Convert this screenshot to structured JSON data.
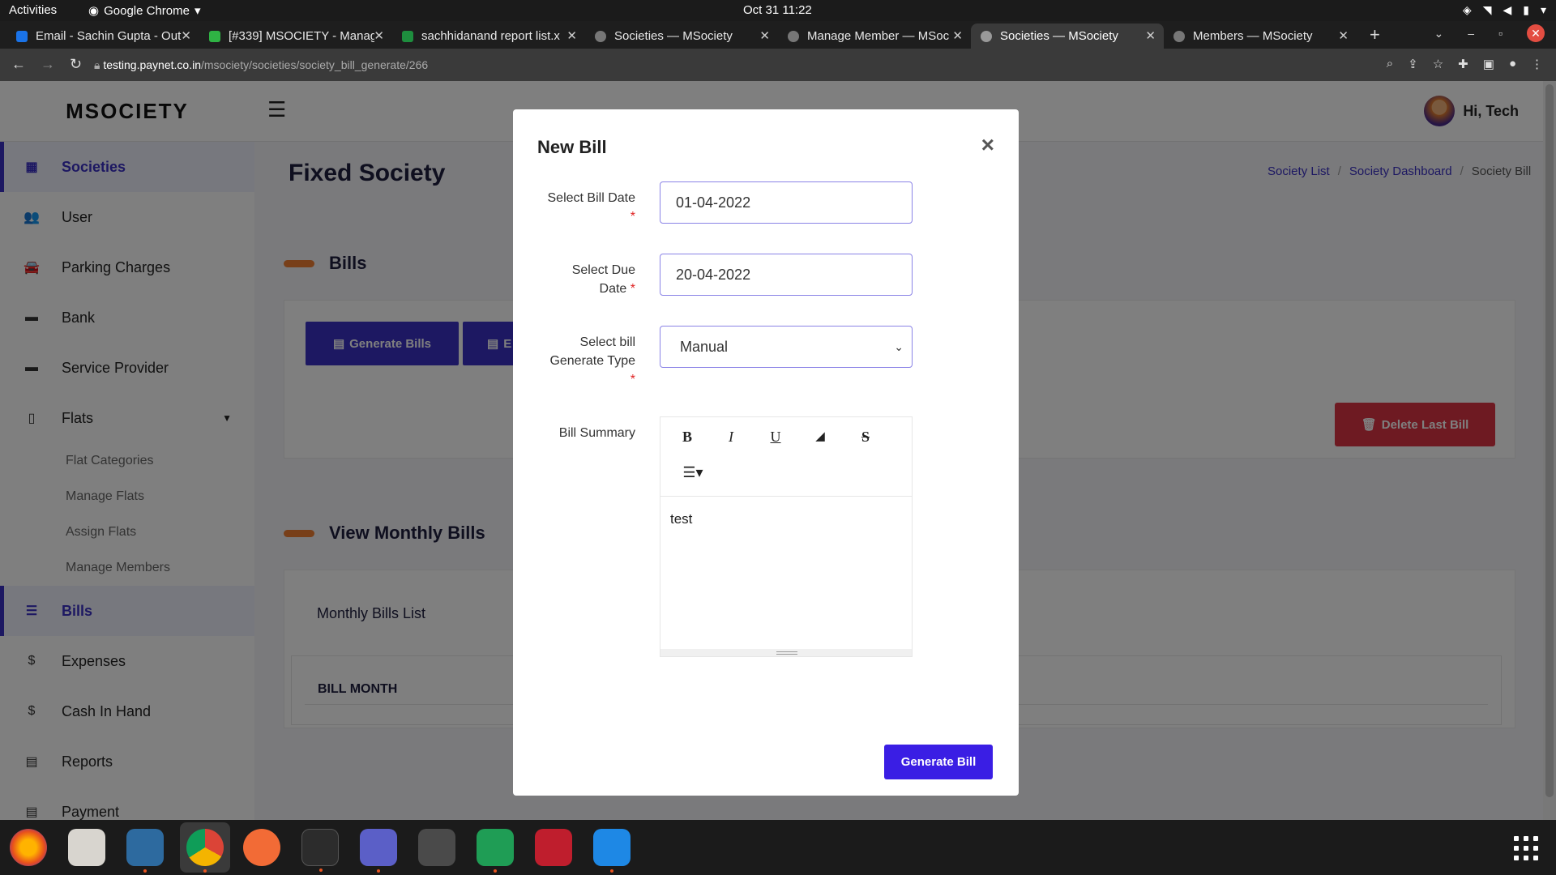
{
  "system": {
    "activities": "Activities",
    "app_name": "Google Chrome",
    "clock": "Oct 31  11:22"
  },
  "browser": {
    "tabs": [
      {
        "title": "Email - Sachin Gupta - Out",
        "favicon_color": "#1a73e8"
      },
      {
        "title": "[#339] MSOCIETY - Manag",
        "favicon_color": "#2fb344"
      },
      {
        "title": "sachhidanand report list.x",
        "favicon_color": "#1e8e3e"
      },
      {
        "title": "Societies — MSociety",
        "favicon_color": "#777777"
      },
      {
        "title": "Manage Member — MSoc",
        "favicon_color": "#777777"
      },
      {
        "title": "Societies — MSociety",
        "favicon_color": "#777777",
        "active": true
      },
      {
        "title": "Members — MSociety",
        "favicon_color": "#777777"
      }
    ],
    "url_host": "testing.paynet.co.in",
    "url_path": "/msociety/societies/society_bill_generate/266"
  },
  "sidebar": {
    "brand": "MSOCIETY",
    "items": [
      {
        "label": "Societies",
        "icon": "table-icon",
        "glyph": "▦",
        "active": true
      },
      {
        "label": "User",
        "icon": "users-icon",
        "glyph": "👥"
      },
      {
        "label": "Parking Charges",
        "icon": "car-icon",
        "glyph": "🚘"
      },
      {
        "label": "Bank",
        "icon": "bank-icon",
        "glyph": "▬"
      },
      {
        "label": "Service Provider",
        "icon": "briefcase-icon",
        "glyph": "▬"
      },
      {
        "label": "Flats",
        "icon": "building-icon",
        "glyph": "▯"
      }
    ],
    "flats_sub": [
      "Flat Categories",
      "Manage Flats",
      "Assign Flats",
      "Manage Members"
    ],
    "items_after": [
      {
        "label": "Bills",
        "icon": "list-icon",
        "glyph": "☰",
        "active": true
      },
      {
        "label": "Expenses",
        "icon": "dollar-icon",
        "glyph": "$"
      },
      {
        "label": "Cash In Hand",
        "icon": "dollar-icon",
        "glyph": "$"
      },
      {
        "label": "Reports",
        "icon": "report-icon",
        "glyph": "▤"
      },
      {
        "label": "Payment",
        "icon": "payment-icon",
        "glyph": "▤"
      }
    ]
  },
  "header": {
    "greeting": "Hi, Tech"
  },
  "page": {
    "title": "Fixed Society",
    "breadcrumb": [
      "Society List",
      "Society Dashboard",
      "Society Bill"
    ],
    "bills_heading": "Bills",
    "generate_bills": "Generate Bills",
    "second_button_partial": "E",
    "delete_last_bill": "Delete Last Bill",
    "view_heading": "View Monthly Bills",
    "monthly_list_title": "Monthly Bills List",
    "col_bill_month": "BILL MONTH"
  },
  "modal": {
    "title": "New Bill",
    "bill_date_label": "Select Bill Date",
    "bill_date_value": "01-04-2022",
    "due_date_label_1": "Select Due",
    "due_date_label_2": "Date",
    "due_date_value": "20-04-2022",
    "gen_type_label_1": "Select bill",
    "gen_type_label_2": "Generate Type",
    "gen_type_value": "Manual",
    "summary_label": "Bill Summary",
    "summary_text": "test",
    "submit": "Generate Bill"
  },
  "colors": {
    "primary": "#3b30c4",
    "danger": "#dc3545",
    "accent": "#f07f32"
  }
}
